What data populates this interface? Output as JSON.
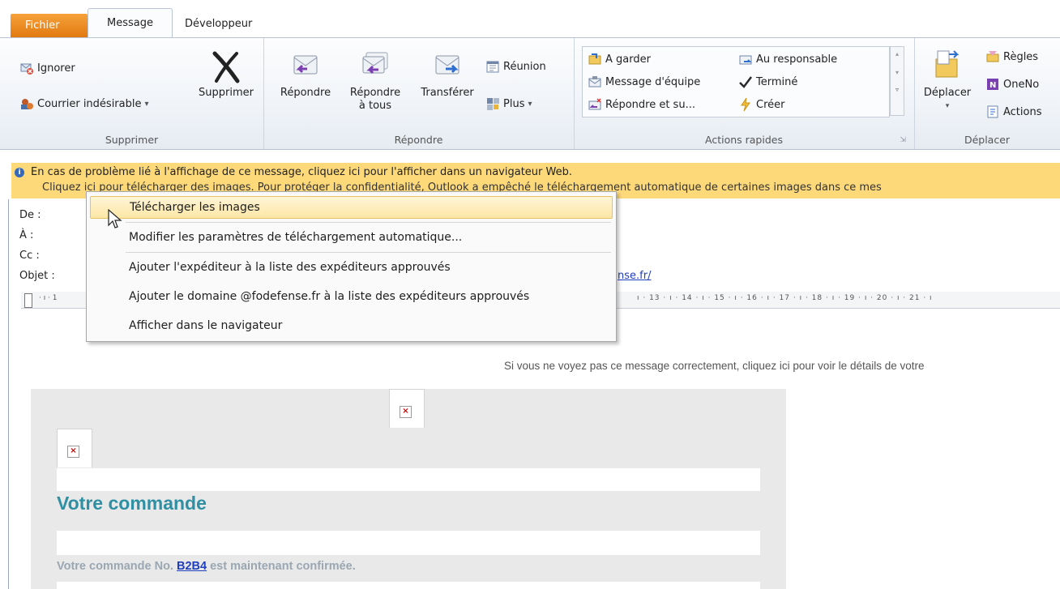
{
  "tabs": {
    "fichier": "Fichier",
    "message": "Message",
    "developpeur": "Développeur"
  },
  "ribbon": {
    "supprimer": {
      "ignorer": "Ignorer",
      "courrier": "Courrier indésirable",
      "supprimer": "Supprimer",
      "label": "Supprimer"
    },
    "repondre": {
      "repondre": "Répondre",
      "repondre_tous_1": "Répondre",
      "repondre_tous_2": "à tous",
      "transferer": "Transférer",
      "reunion": "Réunion",
      "plus": "Plus",
      "label": "Répondre"
    },
    "actions_rapides": {
      "a_garder": "A garder",
      "message_equipe": "Message d'équipe",
      "repondre_su": "Répondre et su...",
      "au_responsable": "Au responsable",
      "termine": "Terminé",
      "creer": "Créer",
      "label": "Actions rapides"
    },
    "deplacer": {
      "deplacer": "Déplacer",
      "regles": "Règles",
      "onenote": "OneNo",
      "actions": "Actions",
      "label": "Déplacer"
    }
  },
  "infobar": {
    "line1": "En cas de problème lié à l'affichage de ce message, cliquez ici pour l'afficher dans un navigateur Web.",
    "line2": "Cliquez ici pour télécharger des images. Pour protéger la confidentialité, Outlook a empêché le téléchargement automatique de certaines images dans ce mes"
  },
  "header": {
    "de": "De :",
    "a": "À :",
    "cc": "Cc :",
    "objet": "Objet :",
    "objet_link": "nse.fr/"
  },
  "ruler": {
    "left": "· ı · 1",
    "right": "ı · 13 · ı · 14 · ı · 15 · ı · 16 · ı · 17 · ı · 18 · ı · 19 · ı · 20 · ı · 21 · ı"
  },
  "context_menu": [
    "Télécharger les images",
    "Modifier les paramètres de téléchargement automatique...",
    "Ajouter l'expéditeur à la liste des expéditeurs approuvés",
    "Ajouter le domaine @fodefense.fr à la liste des expéditeurs approuvés",
    "Afficher dans le navigateur"
  ],
  "email": {
    "topline": "Si vous ne voyez pas ce message correctement, cliquez ici pour voir le détails de votre",
    "heading": "Votre commande",
    "confirm_prefix": "Votre commande No. ",
    "confirm_code": "B2B4",
    "confirm_suffix": " est maintenant confirmée."
  },
  "colors": {
    "fichier_tab": "#e98a1f",
    "infobar": "#fdd97a",
    "heading": "#2f8fa3",
    "link": "#1f3fbf",
    "menu_highlight": "#fde7a6"
  }
}
